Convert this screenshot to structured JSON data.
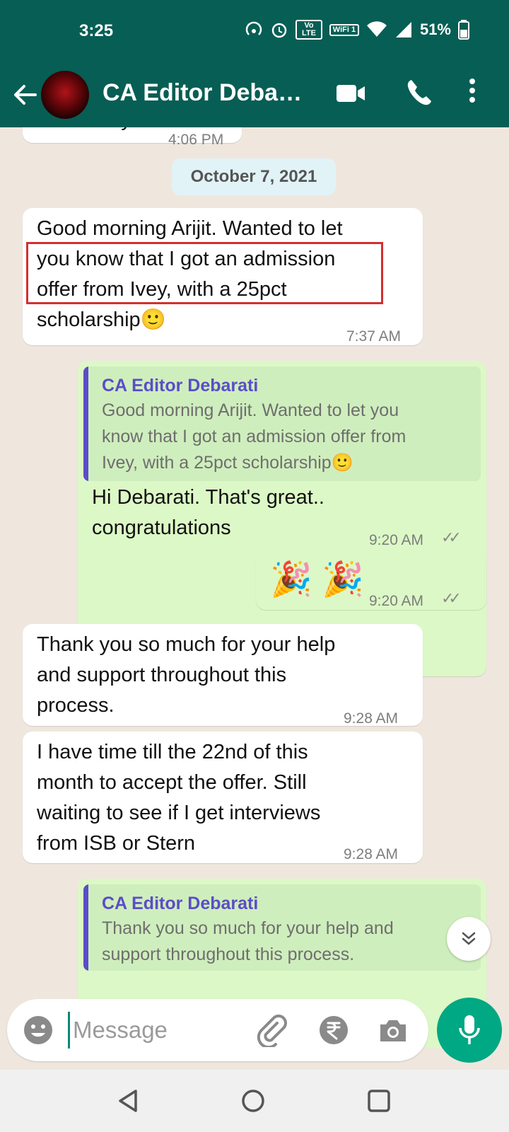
{
  "status": {
    "time": "3:25",
    "battery": "51%",
    "volte": "Vo LTE",
    "wifi": "WiFi 1"
  },
  "header": {
    "title": "CA Editor Deba…"
  },
  "chat": {
    "partial_top": {
      "text": "Absolutely",
      "time": "4:06 PM"
    },
    "date_chip": "October 7, 2021",
    "messages": [
      {
        "direction": "in",
        "lines": [
          "Good morning Arijit. Wanted to let",
          "you know that I got an admission",
          "offer from Ivey, with a 25pct",
          "scholarship🙂"
        ],
        "time": "7:37 AM"
      },
      {
        "direction": "out",
        "quote_author": "CA Editor Debarati",
        "quote_lines": [
          "Good morning Arijit. Wanted to let you",
          "know that I got an admission offer from",
          "Ivey, with a 25pct scholarship🙂"
        ],
        "lines": [
          "Hi Debarati. That's great..",
          "congratulations"
        ],
        "time": "9:20 AM"
      },
      {
        "direction": "out",
        "lines": [
          "🎉 🎉"
        ],
        "time": "9:20 AM"
      },
      {
        "direction": "in",
        "lines": [
          "Thank you so much for your help",
          "and support throughout this",
          "process."
        ],
        "time": "9:28 AM"
      },
      {
        "direction": "in",
        "lines": [
          "I have time till the 22nd of this",
          "month to accept the offer. Still",
          "waiting to see if I get interviews",
          "from ISB or Stern"
        ],
        "time": "9:28 AM"
      },
      {
        "direction": "out",
        "quote_author": "CA Editor Debarati",
        "quote_lines": [
          "Thank you so much for your help and",
          "support throughout this process."
        ]
      }
    ]
  },
  "input": {
    "placeholder": "Message"
  },
  "colors": {
    "header": "#075e54",
    "outgoing": "#dcf8c6",
    "accent": "#00a884",
    "quote_author": "#5b4dc8",
    "highlight": "#d32f2f"
  },
  "icons": [
    "back-arrow-icon",
    "video-call-icon",
    "phone-icon",
    "more-vert-icon",
    "emoji-icon",
    "attach-icon",
    "rupee-icon",
    "camera-icon",
    "mic-icon",
    "chevron-double-down-icon",
    "nav-back-icon",
    "nav-home-icon",
    "nav-recents-icon"
  ]
}
